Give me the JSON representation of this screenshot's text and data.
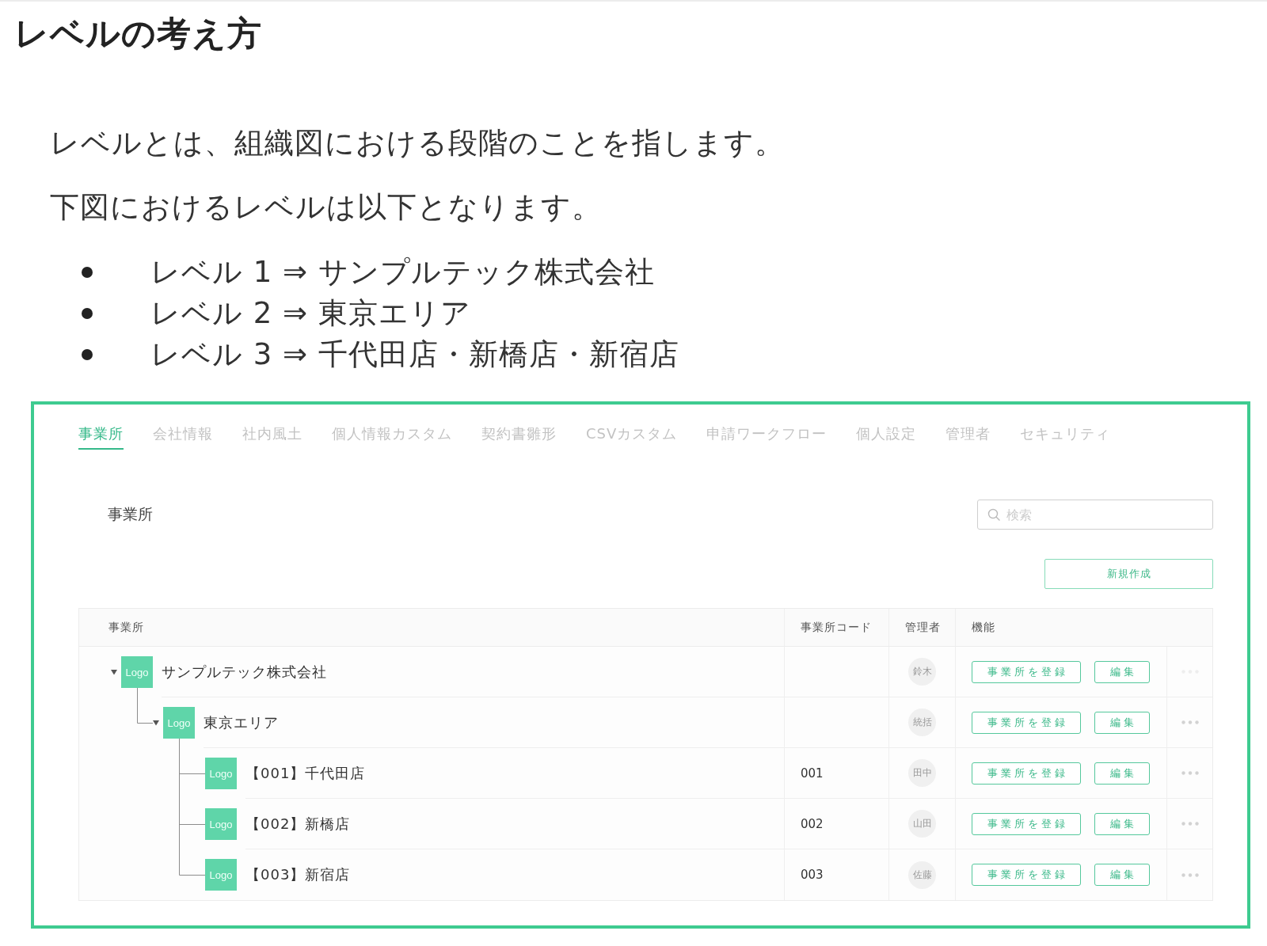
{
  "page": {
    "title": "レベルの考え方",
    "paragraphs": [
      "レベルとは、組織図における段階のことを指します。",
      "下図におけるレベルは以下となります。"
    ],
    "bullets": [
      "レベル 1 ⇒ サンプルテック株式会社",
      "レベル 2 ⇒ 東京エリア",
      "レベル 3 ⇒ 千代田店・新橋店・新宿店"
    ]
  },
  "screenshot": {
    "tabs": [
      {
        "label": "事業所",
        "selected": true
      },
      {
        "label": "会社情報",
        "selected": false
      },
      {
        "label": "社内風土",
        "selected": false
      },
      {
        "label": "個人情報カスタム",
        "selected": false
      },
      {
        "label": "契約書雛形",
        "selected": false
      },
      {
        "label": "CSVカスタム",
        "selected": false
      },
      {
        "label": "申請ワークフロー",
        "selected": false
      },
      {
        "label": "個人設定",
        "selected": false
      },
      {
        "label": "管理者",
        "selected": false
      },
      {
        "label": "セキュリティ",
        "selected": false
      }
    ],
    "section_title": "事業所",
    "search": {
      "placeholder": "検索"
    },
    "new_button": "新規作成",
    "table": {
      "columns": [
        "事業所",
        "事業所コード",
        "管理者",
        "機能"
      ],
      "rows": [
        {
          "logo": "Logo",
          "name": "サンプルテック株式会社",
          "manager": "鈴木",
          "actions": [
            "事業所を登録",
            "編集"
          ],
          "more_disabled": true,
          "expanded": true,
          "children": [
            {
              "logo": "Logo",
              "name": "東京エリア",
              "manager": "統括",
              "actions": [
                "事業所を登録",
                "編集"
              ],
              "more_disabled": false,
              "expanded": true,
              "children": [
                {
                  "logo": "Logo",
                  "name": "【001】千代田店",
                  "code": "001",
                  "manager": "田中",
                  "actions": [
                    "事業所を登録",
                    "編集"
                  ],
                  "more_disabled": false
                },
                {
                  "logo": "Logo",
                  "name": "【002】新橋店",
                  "code": "002",
                  "manager": "山田",
                  "actions": [
                    "事業所を登録",
                    "編集"
                  ],
                  "more_disabled": false
                },
                {
                  "logo": "Logo",
                  "name": "【003】新宿店",
                  "code": "003",
                  "manager": "佐藤",
                  "actions": [
                    "事業所を登録",
                    "編集"
                  ],
                  "more_disabled": false
                }
              ]
            }
          ]
        }
      ]
    }
  }
}
